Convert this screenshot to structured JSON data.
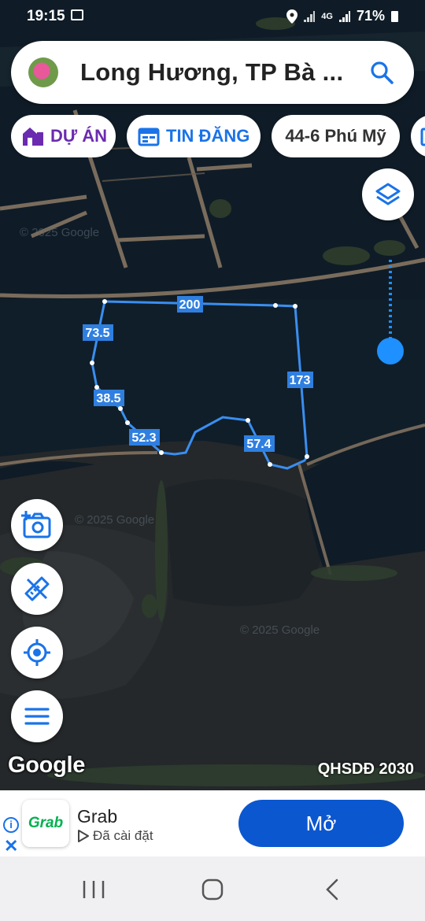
{
  "status_bar": {
    "time": "19:15",
    "battery": "71%",
    "network": "4G"
  },
  "search": {
    "text": "Long Hương, TP Bà ..."
  },
  "chips": [
    {
      "label": "DỰ ÁN",
      "color": "#6a2bb0"
    },
    {
      "label": "TIN ĐĂNG",
      "color": "#1a73e8"
    },
    {
      "label": "44-6 Phú Mỹ",
      "color": "#333333"
    }
  ],
  "map": {
    "measurements": [
      "200",
      "73.5",
      "38.5",
      "52.3",
      "57.4",
      "173"
    ],
    "watermarks": [
      "© 2025 Google",
      "© 2025 Google",
      "© 2025 Google"
    ],
    "google_logo": "Google",
    "layer_label": "QHSDĐ 2030",
    "accent": "#1e90ff"
  },
  "ad": {
    "app_logo": "Grab",
    "app_name": "Grab",
    "subtitle": "Đã cài đặt",
    "button": "Mở",
    "button_color": "#0b57d0"
  }
}
